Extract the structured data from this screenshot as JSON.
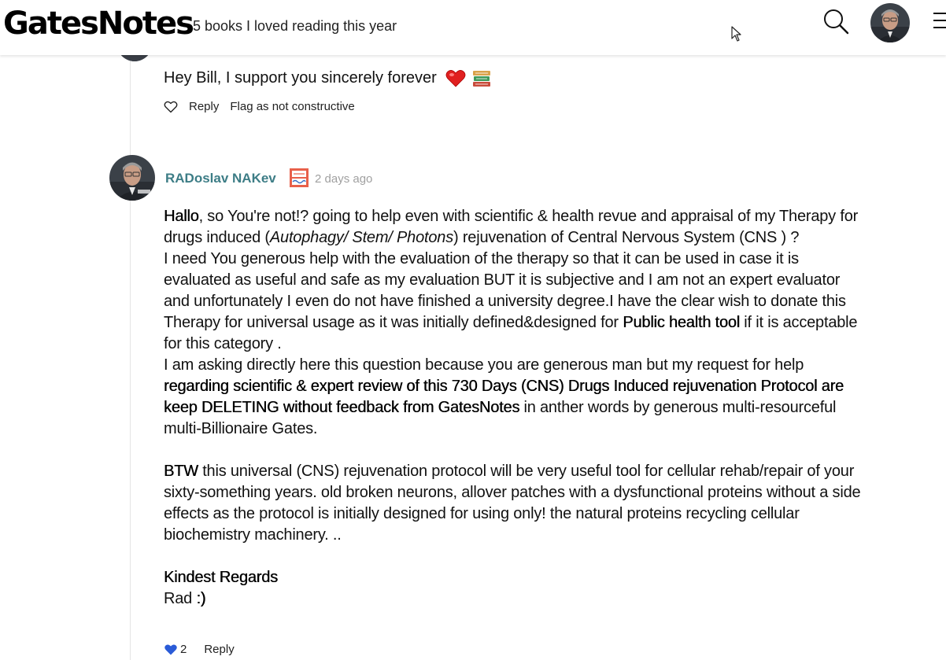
{
  "header": {
    "logo": "GatesNotes",
    "page_title": "5 books I loved reading this year"
  },
  "previous_comment": {
    "text": "Hey Bill, I support you sincerely forever",
    "emoji": [
      "red-heart",
      "books"
    ],
    "reply_label": "Reply",
    "flag_label": "Flag as not constructive"
  },
  "comment": {
    "author": "RADoslav NAKev",
    "time": "2 days ago",
    "body": {
      "p1_a": "Hallo",
      "p1_b": ", so You're not!? going to help even with scientific & health revue and appraisal of my Therapy for drugs induced (",
      "p1_i": "Autophagy/ Stem/ Photons",
      "p1_c": ") rejuvenation of Central Nervous System (CNS ) ?",
      "p2_a": "I need You generous help with the evaluation of the therapy so that it can be used in case it is evaluated as useful and safe as my evaluation BUT it is subjective and I am not an expert evaluator and unfortunately I even do not have finished a university degree.I have the clear wish to donate this Therapy for universal usage as it was initially defined&designed for ",
      "p2_b": "Public health tool",
      "p2_c": " if it is acceptable for this category .",
      "p3_a": "I am asking directly here this question because you are generous man but my request for help ",
      "p3_b": "regarding scientific & expert review of this 730 Days (CNS) Drugs Induced rejuvenation Protocol are keep DELETING without feedback from GatesNotes",
      "p3_c": " in anther words by generous multi-resourceful multi-Billionaire Gates.",
      "p4_a": "BTW",
      "p4_b": " this universal (CNS) rejuvenation protocol will be very useful tool for cellular rehab/repair of your sixty-something years. old broken neurons, allover patches with a dysfunctional proteins without a side effects as the protocol is initially designed for using only! the natural proteins recycling cellular biochemistry machinery. ..",
      "sign1": "Kindest Regards",
      "sign2_a": "Rad ",
      "sign2_b": ":)"
    },
    "likes": "2",
    "reply_label": "Reply"
  },
  "colors": {
    "author": "#3d7d86",
    "like_active": "#2a5bd7",
    "timestamp": "#a0a0a0"
  }
}
